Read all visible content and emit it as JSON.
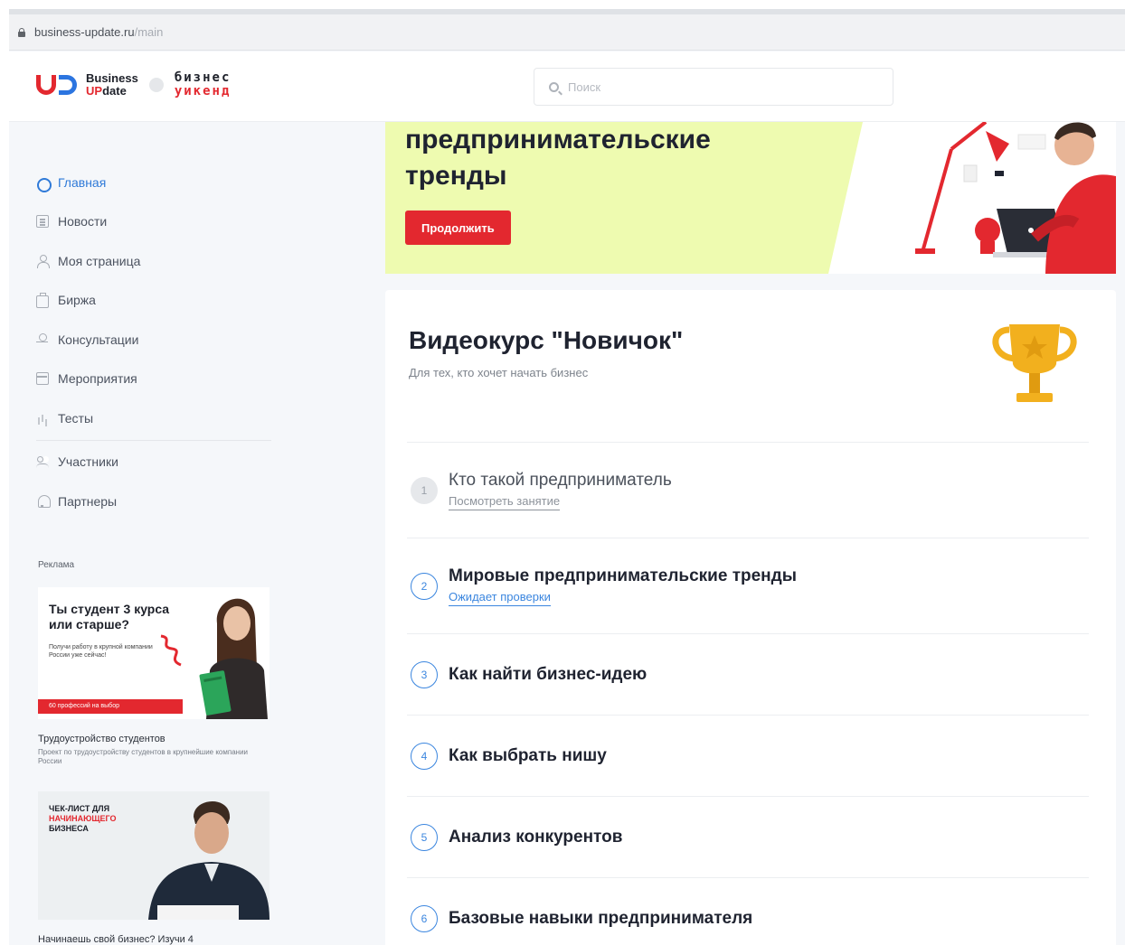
{
  "browser": {
    "url_host": "business-update.ru",
    "url_path": "/main"
  },
  "header": {
    "logo_line1": "Business",
    "logo_line2_up": "UP",
    "logo_line2_rest": "date",
    "partner_line1": "бизнес",
    "partner_line2": "уикенд",
    "search_placeholder": "Поиск"
  },
  "sidebar": {
    "items": [
      {
        "label": "Главная",
        "icon": "home-icon"
      },
      {
        "label": "Новости",
        "icon": "news-icon"
      },
      {
        "label": "Моя страница",
        "icon": "user-icon"
      },
      {
        "label": "Биржа",
        "icon": "briefcase-icon"
      },
      {
        "label": "Консультации",
        "icon": "consultant-icon"
      },
      {
        "label": "Мероприятия",
        "icon": "calendar-icon"
      },
      {
        "label": "Тесты",
        "icon": "chart-icon"
      },
      {
        "label": "Участники",
        "icon": "members-icon"
      },
      {
        "label": "Партнеры",
        "icon": "partner-icon"
      }
    ],
    "ads_label": "Реклама",
    "ad1": {
      "title_line1": "Ты студент 3 курса",
      "title_line2": "или старше?",
      "subtitle": "Получи работу в крупной компании России уже сейчас!",
      "bar": "60 профессий на выбор",
      "caption": "Трудоустройство студентов",
      "desc": "Проект по трудоустройству студентов в крупнейшие компании России"
    },
    "ad2": {
      "line1": "ЧЕК-ЛИСТ ДЛЯ",
      "line2": "НАЧИНАЮЩЕГО",
      "line3": "БИЗНЕСА",
      "caption": "Начинаешь свой бизнес? Изучи 4"
    }
  },
  "hero": {
    "title_line1": "предпринимательские",
    "title_line2": "тренды",
    "button": "Продолжить"
  },
  "course": {
    "title": "Видеокурс \"Новичок\"",
    "subtitle": "Для тех, кто хочет начать бизнес",
    "lessons": [
      {
        "num": "1",
        "title": "Кто такой предприниматель",
        "status": "Посмотреть занятие"
      },
      {
        "num": "2",
        "title": "Мировые предпринимательские тренды",
        "status": "Ожидает проверки"
      },
      {
        "num": "3",
        "title": "Как найти бизнес-идею"
      },
      {
        "num": "4",
        "title": "Как выбрать нишу"
      },
      {
        "num": "5",
        "title": "Анализ конкурентов"
      },
      {
        "num": "6",
        "title": "Базовые навыки предпринимателя"
      }
    ]
  },
  "colors": {
    "accent_blue": "#2f7ad8",
    "brand_red": "#e3282f",
    "hero_green": "#eefbb0"
  }
}
